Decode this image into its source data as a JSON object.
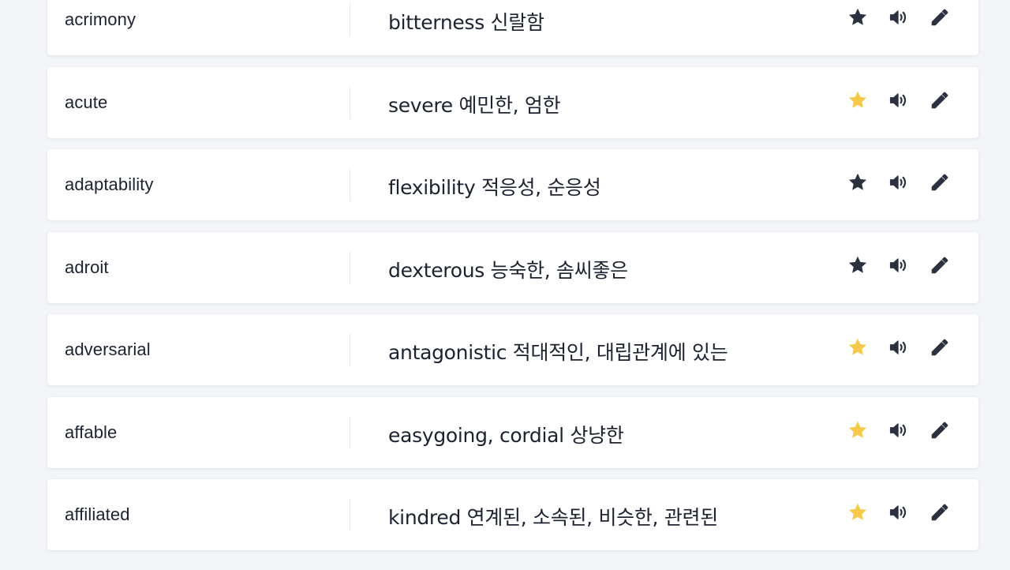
{
  "colors": {
    "star_on": "#f6c94a",
    "star_off": "#2c3140",
    "icon": "#2c3140",
    "card_bg": "#ffffff",
    "page_bg": "#f3f5f8"
  },
  "icons": {
    "favorite": "star-icon",
    "speak": "speaker-icon",
    "edit": "pencil-icon"
  },
  "words": [
    {
      "term": "acrimony",
      "meaning": "bitterness 신랄함",
      "starred": false
    },
    {
      "term": "acute",
      "meaning": "severe 예민한, 엄한",
      "starred": true
    },
    {
      "term": "adaptability",
      "meaning": "flexibility 적응성, 순응성",
      "starred": false
    },
    {
      "term": "adroit",
      "meaning": "dexterous 능숙한, 솜씨좋은",
      "starred": false
    },
    {
      "term": "adversarial",
      "meaning": "antagonistic 적대적인, 대립관계에 있는",
      "starred": true
    },
    {
      "term": "affable",
      "meaning": "easygoing, cordial 상냥한",
      "starred": true
    },
    {
      "term": "affiliated",
      "meaning": "kindred 연계된, 소속된, 비슷한, 관련된",
      "starred": true
    }
  ]
}
